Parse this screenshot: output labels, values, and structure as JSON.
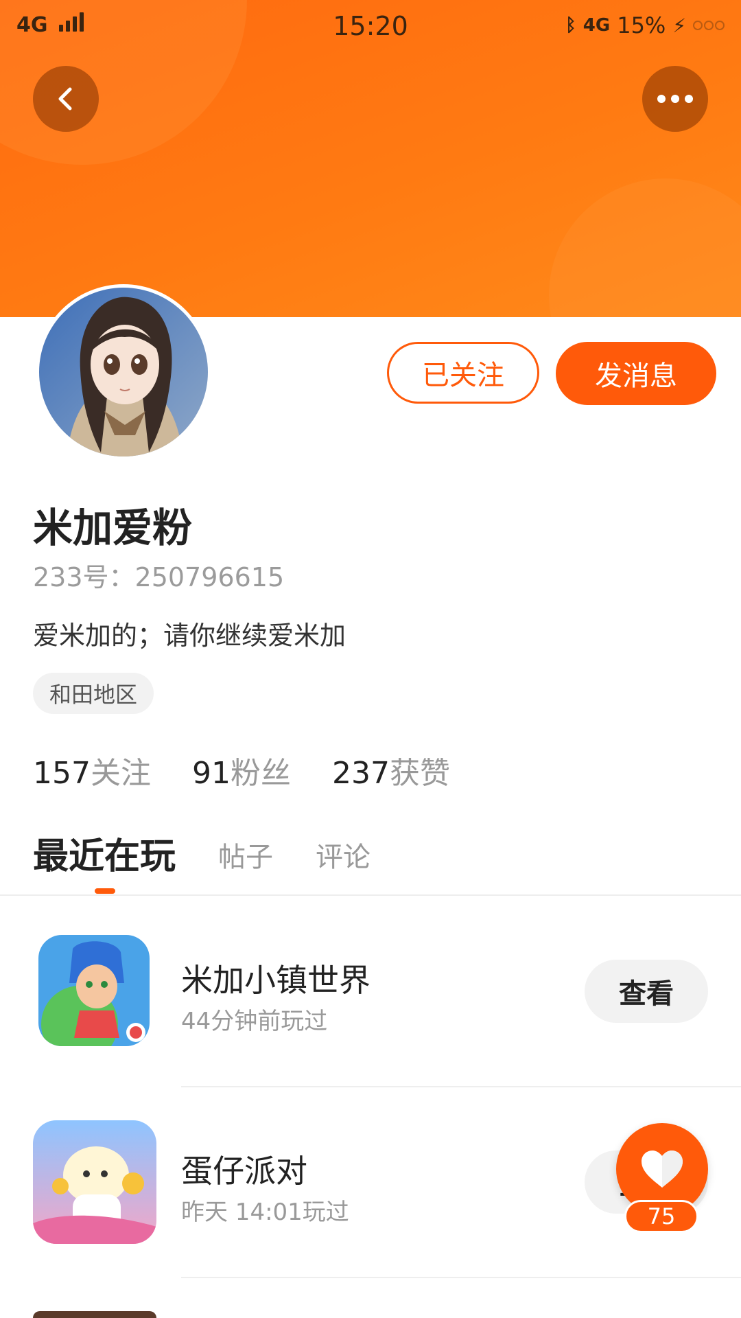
{
  "status_bar": {
    "network": "4G",
    "time": "15:20",
    "right_network": "4G",
    "battery": "15%"
  },
  "header": {
    "back_icon": "chevron-left-icon",
    "more_icon": "more-horizontal-icon",
    "background_color": "#ff6a10"
  },
  "profile": {
    "followed_button": "已关注",
    "message_button": "发消息",
    "username": "米加爱粉",
    "id_text": "233号：250796615",
    "bio": "爱米加的；请你继续爱米加",
    "region": "和田地区",
    "stats": [
      {
        "num": "157",
        "label": "关注"
      },
      {
        "num": "91",
        "label": "粉丝"
      },
      {
        "num": "237",
        "label": "获赞"
      }
    ]
  },
  "tabs": [
    {
      "label": "最近在玩",
      "active": true
    },
    {
      "label": "帖子",
      "active": false
    },
    {
      "label": "评论",
      "active": false
    }
  ],
  "games": [
    {
      "title": "米加小镇世界",
      "subtitle": "44分钟前玩过",
      "button": "查看"
    },
    {
      "title": "蛋仔派对",
      "subtitle": "昨天 14:01玩过",
      "button": "查看"
    }
  ],
  "fab": {
    "icon": "heart-icon",
    "count": "75"
  },
  "accent_color": "#ff5a0a"
}
